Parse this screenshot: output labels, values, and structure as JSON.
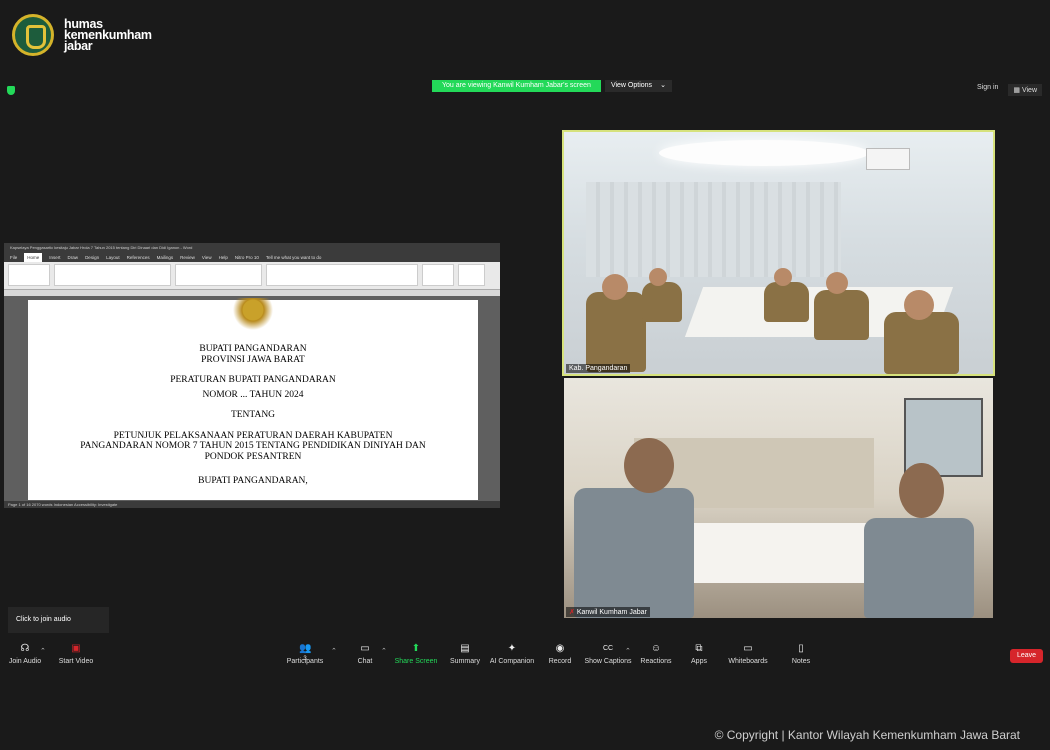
{
  "brand": {
    "line1": "humas",
    "line2": "kemenkumham",
    "line3": "jabar"
  },
  "banner": {
    "text": "You are viewing Kanwil Kumham Jabar's screen",
    "view_options": "View Options"
  },
  "top_right": {
    "sign_in": "Sign in",
    "view": "View"
  },
  "word": {
    "title": "Kapselaya Penggasartic kesitaju Jabar Hrola 7 Tahun 2015 tentang Diri Dinaari dan Didi Iganon - Word",
    "tabs": [
      "File",
      "Home",
      "Insert",
      "Draw",
      "Design",
      "Layout",
      "References",
      "Mailings",
      "Review",
      "View",
      "Help",
      "Nitro Pro 10"
    ],
    "tell_me": "Tell me what you want to do",
    "status": "Page 1 of 16   2070 words   Indonesian   Accessibility: Investigate"
  },
  "document": {
    "lines": [
      "BUPATI PANGANDARAN",
      "PROVINSI JAWA BARAT",
      "PERATURAN BUPATI PANGANDARAN",
      "NOMOR ... TAHUN 2024",
      "TENTANG",
      "PETUNJUK PELAKSANAAN PERATURAN DAERAH KABUPATEN",
      "PANGANDARAN NOMOR 7 TAHUN 2015 TENTANG PENDIDIKAN DINIYAH DAN",
      "PONDOK PESANTREN",
      "BUPATI PANGANDARAN,"
    ]
  },
  "participants": [
    {
      "name": "Kab. Pangandaran"
    },
    {
      "name": "Kanwil Kumham Jabar"
    }
  ],
  "tooltip": "Click to join audio",
  "toolbar": {
    "join_audio": "Join Audio",
    "start_video": "Start Video",
    "participants": "Participants",
    "participants_count": "3",
    "chat": "Chat",
    "share_screen": "Share Screen",
    "summary": "Summary",
    "ai_companion": "AI Companion",
    "record": "Record",
    "show_captions": "Show Captions",
    "reactions": "Reactions",
    "apps": "Apps",
    "whiteboards": "Whiteboards",
    "notes": "Notes",
    "leave": "Leave"
  },
  "icons": {
    "join_audio": "headphones-icon",
    "start_video": "video-off-icon",
    "participants": "people-icon",
    "chat": "chat-bubble-icon",
    "share_screen": "share-up-arrow-icon",
    "summary": "document-icon",
    "ai_companion": "sparkle-icon",
    "record": "record-circle-icon",
    "show_captions": "cc-icon",
    "reactions": "smiley-plus-icon",
    "apps": "apps-icon",
    "whiteboards": "whiteboard-icon",
    "notes": "notes-icon"
  },
  "colors": {
    "accent": "#23d959",
    "leave": "#d6252b",
    "active_speaker": "#d6e27c",
    "background": "#1a1a1a"
  },
  "copyright": "© Copyright | Kantor Wilayah Kemenkumham Jawa Barat"
}
